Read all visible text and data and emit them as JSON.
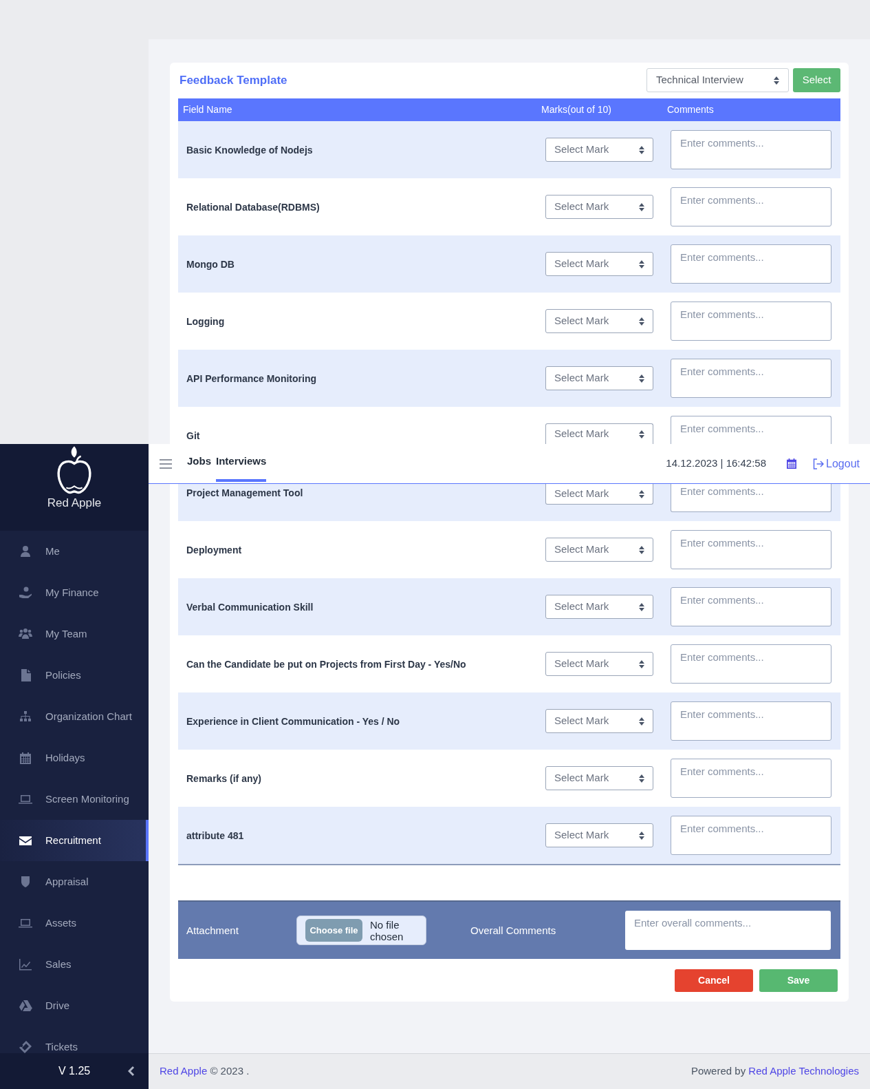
{
  "header": {
    "tabs": [
      {
        "label": "Jobs",
        "selected": false
      },
      {
        "label": "Interviews",
        "selected": true
      }
    ],
    "datetime": "14.12.2023 | 16:42:58",
    "logout": "Logout"
  },
  "sidebar": {
    "logo_text": "Red Apple",
    "items": [
      {
        "label": "Me",
        "selected": false
      },
      {
        "label": "My Finance",
        "selected": false
      },
      {
        "label": "My Team",
        "selected": false
      },
      {
        "label": "Policies",
        "selected": false
      },
      {
        "label": "Organization Chart",
        "selected": false
      },
      {
        "label": "Holidays",
        "selected": false
      },
      {
        "label": "Screen Monitoring",
        "selected": false
      },
      {
        "label": "Recruitment",
        "selected": true
      },
      {
        "label": "Appraisal",
        "selected": false
      },
      {
        "label": "Assets",
        "selected": false
      },
      {
        "label": "Sales",
        "selected": false
      },
      {
        "label": "Drive",
        "selected": false
      },
      {
        "label": "Tickets",
        "selected": false
      }
    ],
    "version": "V 1.25"
  },
  "card": {
    "title": "Feedback Template",
    "template_select": {
      "value": "Technical Interview"
    },
    "select_button": "Select",
    "table": {
      "columns": [
        "Field Name",
        "Marks(out of 10)",
        "Comments"
      ],
      "rows": [
        {
          "field": "Basic Knowledge of Nodejs",
          "mark": "Select Mark",
          "comments_placeholder": "Enter comments..."
        },
        {
          "field": "Relational Database(RDBMS)",
          "mark": "Select Mark",
          "comments_placeholder": "Enter comments..."
        },
        {
          "field": "Mongo DB",
          "mark": "Select Mark",
          "comments_placeholder": "Enter comments..."
        },
        {
          "field": "Logging",
          "mark": "Select Mark",
          "comments_placeholder": "Enter comments..."
        },
        {
          "field": "API Performance Monitoring",
          "mark": "Select Mark",
          "comments_placeholder": "Enter comments..."
        },
        {
          "field": "Git",
          "mark": "Select Mark",
          "comments_placeholder": "Enter comments..."
        },
        {
          "field": "Project Management Tool",
          "mark": "Select Mark",
          "comments_placeholder": "Enter comments..."
        },
        {
          "field": "Deployment",
          "mark": "Select Mark",
          "comments_placeholder": "Enter comments..."
        },
        {
          "field": "Verbal Communication Skill",
          "mark": "Select Mark",
          "comments_placeholder": "Enter comments..."
        },
        {
          "field": "Can the Candidate be put on Projects from First Day - Yes/No",
          "mark": "Select Mark",
          "comments_placeholder": "Enter comments..."
        },
        {
          "field": "Experience in Client Communication - Yes / No",
          "mark": "Select Mark",
          "comments_placeholder": "Enter comments..."
        },
        {
          "field": "Remarks (if any)",
          "mark": "Select Mark",
          "comments_placeholder": "Enter comments..."
        },
        {
          "field": "attribute 481",
          "mark": "Select Mark",
          "comments_placeholder": "Enter comments..."
        }
      ]
    },
    "attachment": {
      "label": "Attachment",
      "file_button": "Choose file",
      "file_status": "No file chosen",
      "overall_label": "Overall Comments",
      "overall_placeholder": "Enter overall comments..."
    },
    "actions": [
      {
        "label": "Cancel",
        "kind": "cancel"
      },
      {
        "label": "Save",
        "kind": "save"
      }
    ]
  },
  "footer": {
    "brand": "Red Apple",
    "copyright": "© 2023 .",
    "powered_by": "Powered by",
    "company": "Red Apple Technologies"
  }
}
